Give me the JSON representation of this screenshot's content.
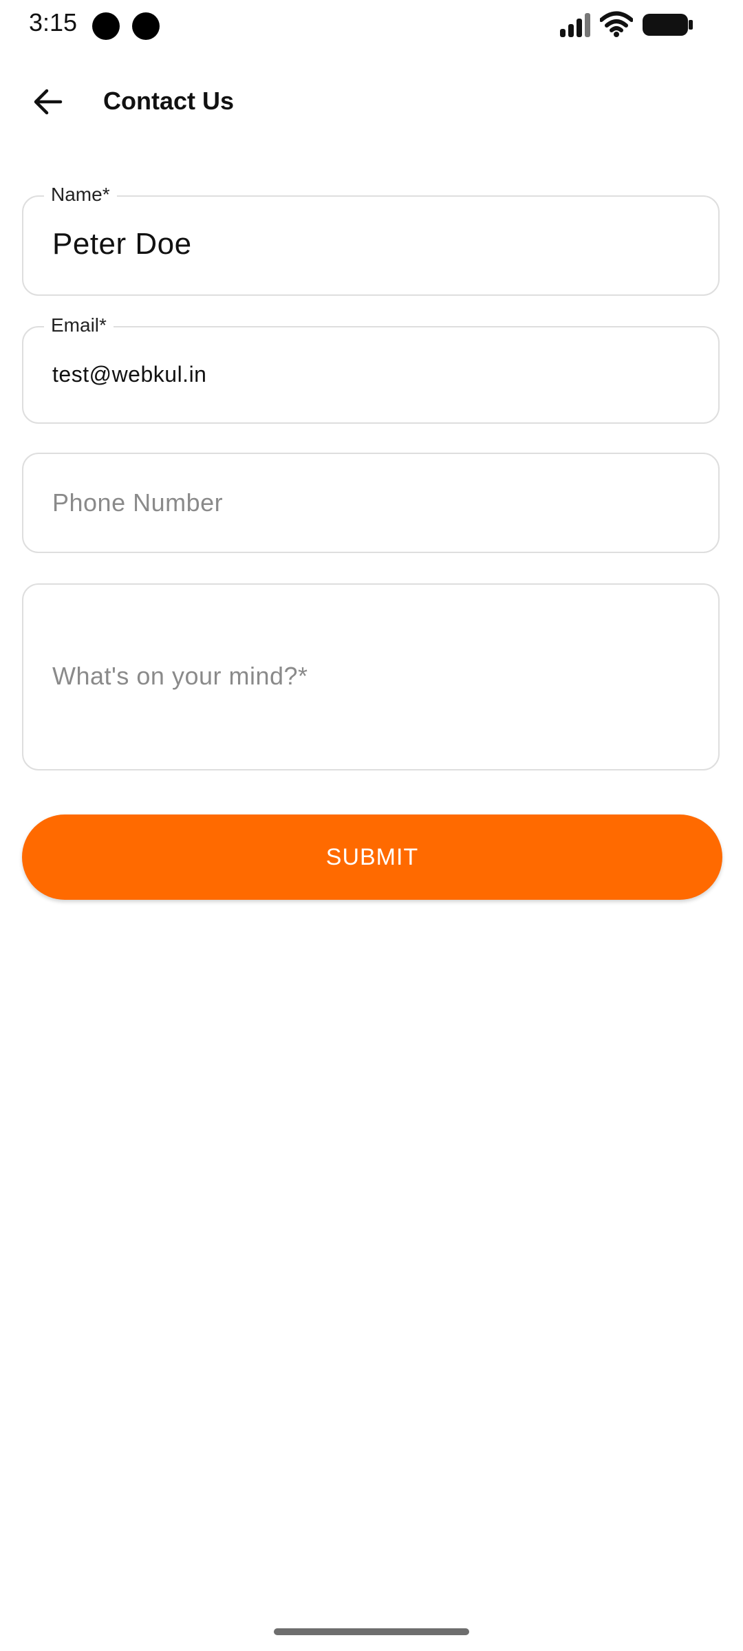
{
  "status_bar": {
    "time": "3:15",
    "icons": [
      "signal-icon",
      "wifi-icon",
      "battery-icon"
    ]
  },
  "app_bar": {
    "back_icon": "arrow-left-icon",
    "title": "Contact Us"
  },
  "form": {
    "name": {
      "label": "Name*",
      "value": "Peter Doe"
    },
    "email": {
      "label": "Email*",
      "value": "test@webkul.in"
    },
    "phone": {
      "placeholder": "Phone Number"
    },
    "message": {
      "placeholder": "What's on your mind?*"
    },
    "submit_label": "SUBMIT"
  },
  "colors": {
    "accent": "#ff6a00",
    "border": "#dedede",
    "placeholder": "#8a8a8a"
  }
}
